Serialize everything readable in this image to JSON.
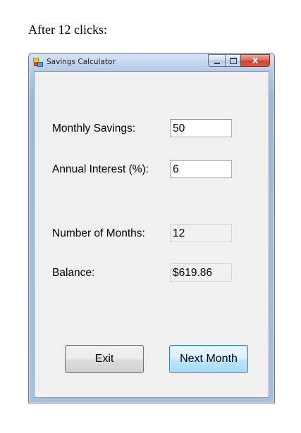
{
  "caption": "After 12 clicks:",
  "window": {
    "title": "Savings Calculator",
    "icon": "app-form-icon",
    "controls": {
      "minimize": "minimize-icon",
      "maximize": "maximize-icon",
      "close_glyph": "X"
    }
  },
  "form": {
    "monthly_savings": {
      "label": "Monthly Savings:",
      "value": "50"
    },
    "annual_interest": {
      "label": "Annual Interest (%):",
      "value": "6"
    },
    "number_of_months": {
      "label": "Number of Months:",
      "value": "12"
    },
    "balance": {
      "label": "Balance:",
      "value": "$619.86"
    }
  },
  "buttons": {
    "exit": "Exit",
    "next_month": "Next Month"
  },
  "colors": {
    "client_background": "#f0f0f0",
    "frame": "#b9cbe5",
    "close_button": "#c6452c",
    "focused_button_border": "#3c7fb1"
  }
}
